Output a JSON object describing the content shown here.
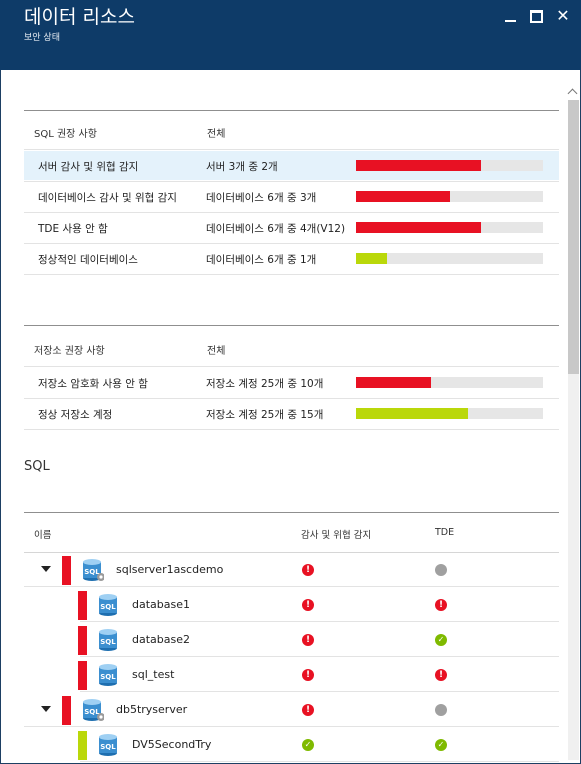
{
  "window": {
    "title": "데이터 리소스",
    "subtitle": "보안 상태",
    "close_glyph": "✕"
  },
  "sql_recommendations": {
    "header_label": "SQL 권장 사항",
    "header_total": "전체",
    "rows": [
      {
        "label": "서버 감사 및 위협 감지",
        "total": "서버 3개 중 2개",
        "fraction": 0.667,
        "status_color": "#e81123"
      },
      {
        "label": "데이터베이스 감사 및 위협 감지",
        "total": "데이터베이스 6개 중 3개",
        "fraction": 0.5,
        "status_color": "#e81123"
      },
      {
        "label": "TDE 사용 안 함",
        "total": "데이터베이스 6개 중 4개(V12)",
        "fraction": 0.667,
        "status_color": "#e81123"
      },
      {
        "label": "정상적인 데이터베이스",
        "total": "데이터베이스 6개 중 1개",
        "fraction": 0.167,
        "status_color": "#bad80a"
      }
    ]
  },
  "storage_recommendations": {
    "header_label": "저장소 권장 사항",
    "header_total": "전체",
    "rows": [
      {
        "label": "저장소 암호화 사용 안 함",
        "total": "저장소 계정 25개 중 10개",
        "fraction": 0.4,
        "status_color": "#e81123"
      },
      {
        "label": "정상 저장소 계정",
        "total": "저장소 계정 25개 중 15개",
        "fraction": 0.6,
        "status_color": "#bad80a"
      }
    ]
  },
  "sql_section": {
    "title": "SQL",
    "columns": {
      "name": "이름",
      "audit": "감사 및 위협 감지",
      "tde": "TDE"
    },
    "icon_text": "SQL",
    "rows": [
      {
        "name": "sqlserver1ascdemo",
        "type": "server",
        "strip_color": "#e81123",
        "audit": "error",
        "tde": "na"
      },
      {
        "name": "database1",
        "type": "database",
        "strip_color": "#e81123",
        "audit": "error",
        "tde": "error"
      },
      {
        "name": "database2",
        "type": "database",
        "strip_color": "#e81123",
        "audit": "error",
        "tde": "ok"
      },
      {
        "name": "sql_test",
        "type": "database",
        "strip_color": "#e81123",
        "audit": "error",
        "tde": "error"
      },
      {
        "name": "db5tryserver",
        "type": "server",
        "strip_color": "#e81123",
        "audit": "error",
        "tde": "na"
      },
      {
        "name": "DV5SecondTry",
        "type": "database",
        "strip_color": "#bad80a",
        "audit": "ok",
        "tde": "ok"
      }
    ]
  },
  "colors": {
    "title_bar": "#0e3b68",
    "error": "#e81123",
    "healthy": "#bad80a",
    "ok_icon": "#7fba00",
    "db_icon": "#3b8fd0"
  }
}
